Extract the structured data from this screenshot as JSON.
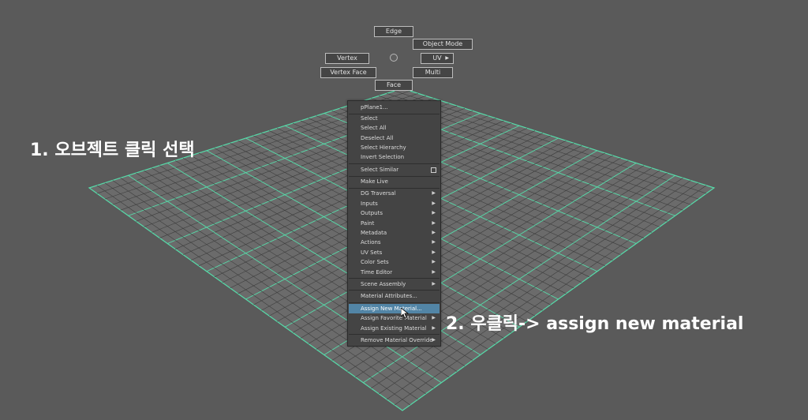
{
  "marking_menu": {
    "edge": "Edge",
    "object_mode": "Object Mode",
    "vertex": "Vertex",
    "uv": "UV",
    "vertex_face": "Vertex Face",
    "multi": "Multi",
    "face": "Face"
  },
  "context_menu": {
    "header": "pPlane1...",
    "items": [
      {
        "label": "Select"
      },
      {
        "label": "Select All"
      },
      {
        "label": "Deselect All"
      },
      {
        "label": "Select Hierarchy"
      },
      {
        "label": "Invert Selection"
      },
      {
        "label": "Select Similar"
      },
      {
        "label": "Make Live"
      },
      {
        "label": "DG Traversal"
      },
      {
        "label": "Inputs"
      },
      {
        "label": "Outputs"
      },
      {
        "label": "Paint"
      },
      {
        "label": "Metadata"
      },
      {
        "label": "Actions"
      },
      {
        "label": "UV Sets"
      },
      {
        "label": "Color Sets"
      },
      {
        "label": "Time Editor"
      },
      {
        "label": "Scene Assembly"
      },
      {
        "label": "Material Attributes..."
      },
      {
        "label": "Assign New Material..."
      },
      {
        "label": "Assign Favorite Material"
      },
      {
        "label": "Assign Existing Material"
      },
      {
        "label": "Remove Material Override"
      }
    ],
    "highlighted": "Assign New Material..."
  },
  "annotations": {
    "step1": "1. 오브젝트 클릭 선택",
    "step2": "2. 우클릭-> assign new material"
  },
  "colors": {
    "background": "#5a5a5a",
    "plane": "#6b6b6b",
    "grid_major": "#56dcaa",
    "grid_minor": "#3e3e3e",
    "menu_bg": "#444444",
    "highlight": "#5285a6"
  }
}
